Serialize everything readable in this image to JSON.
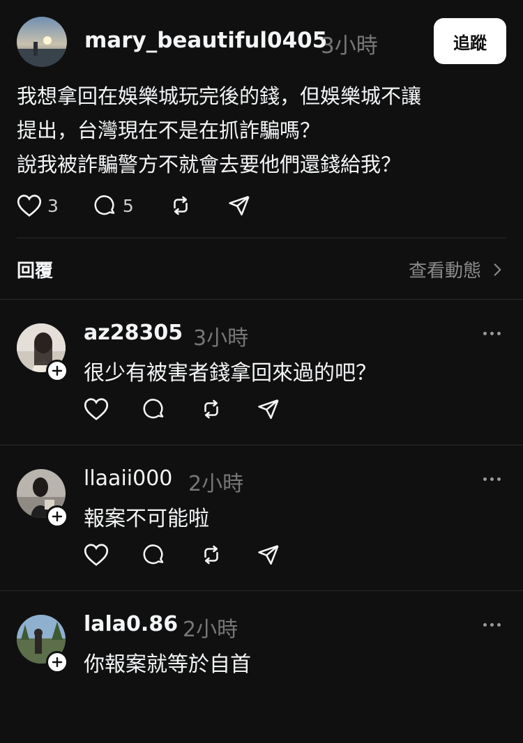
{
  "post": {
    "username": "mary_beautiful0405",
    "time": "3小時",
    "follow_label": "追蹤",
    "lines": [
      "我想拿回在娛樂城玩完後的錢，但娛樂城不讓",
      "提出，台灣現在不是在抓詐騙嗎？",
      "說我被詐騙警方不就會去要他們還錢給我？"
    ],
    "like_count": "3",
    "reply_count": "5"
  },
  "replies_bar": {
    "label": "回覆",
    "activity_link": "查看動態"
  },
  "comments": [
    {
      "username": "az28305",
      "time": "3小時",
      "text": "很少有被害者錢拿回來過的吧？"
    },
    {
      "username": "llaaii000",
      "time": "2小時",
      "text": "報案不可能啦"
    },
    {
      "username": "lala0.86",
      "time": "2小時",
      "text": "你報案就等於自首"
    }
  ],
  "colors": {
    "background": "#101010",
    "text": "#f3f5f7",
    "muted": "#777777",
    "divider": "#2a2a2a",
    "button_bg": "#ffffff"
  }
}
